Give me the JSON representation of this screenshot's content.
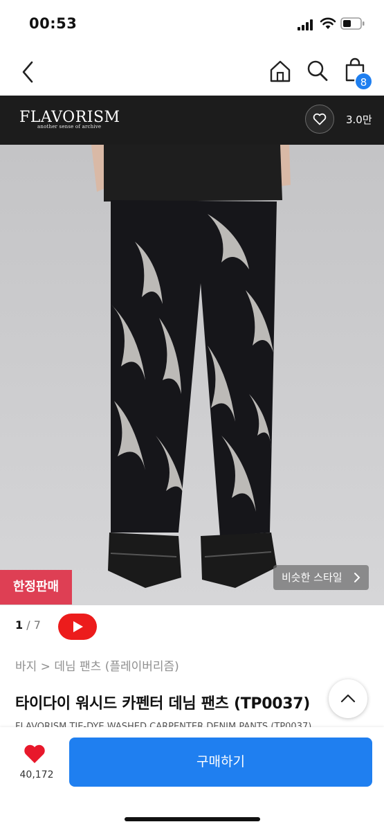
{
  "status": {
    "time": "00:53"
  },
  "nav": {
    "bag_count": "8"
  },
  "brand": {
    "name": "FLAVORISM",
    "tagline": "another sense of archive",
    "like_count": "3.0만"
  },
  "image": {
    "limited_label": "한정판매",
    "similar_label": "비슷한 스타일",
    "counter_current": "1",
    "counter_total": " / 7"
  },
  "product": {
    "breadcrumb": "바지 > 데님 팬츠 (플레이버리즘)",
    "title": "타이다이 워시드 카펜터 데님 팬츠 (TP0037)",
    "subtitle": "FLAVORISM TIE-DYE WASHED CARPENTER DENIM PANTS (TP0037)"
  },
  "bottom": {
    "wish_count": "40,172",
    "buy_label": "구매하기"
  },
  "colors": {
    "accent": "#1f7ff0",
    "limited": "#de3f54",
    "brand_bar": "#1c1c1c"
  }
}
